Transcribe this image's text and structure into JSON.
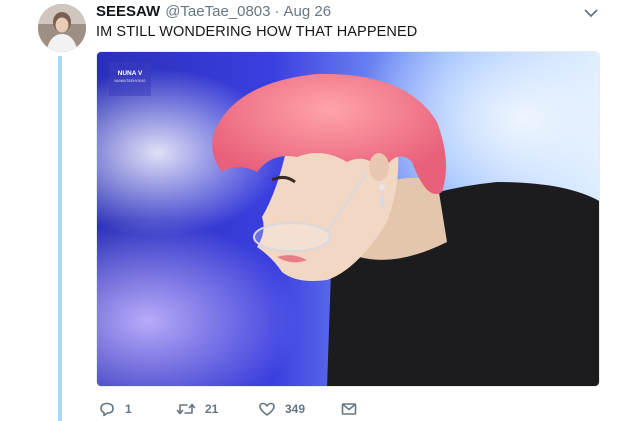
{
  "tweet": {
    "display_name": "SEESAW",
    "handle": "@TaeTae_0803",
    "separator": "·",
    "time": "Aug 26",
    "text": "IM STILL WONDERING HOW THAT HAPPENED"
  },
  "media": {
    "watermark_title": "NUNA V",
    "watermark_sub": "NUNAVTAEHYUNG"
  },
  "actions": {
    "reply": {
      "icon": "reply-icon",
      "count": "1"
    },
    "retweet": {
      "icon": "retweet-icon",
      "count": "21"
    },
    "like": {
      "icon": "heart-icon",
      "count": "349"
    },
    "message": {
      "icon": "envelope-icon"
    }
  },
  "colors": {
    "thread_line": "#a7d8f6",
    "text_primary": "#14171a",
    "text_secondary": "#657786",
    "hair": "#f07a86",
    "background_blue": "#2e3fd6"
  }
}
